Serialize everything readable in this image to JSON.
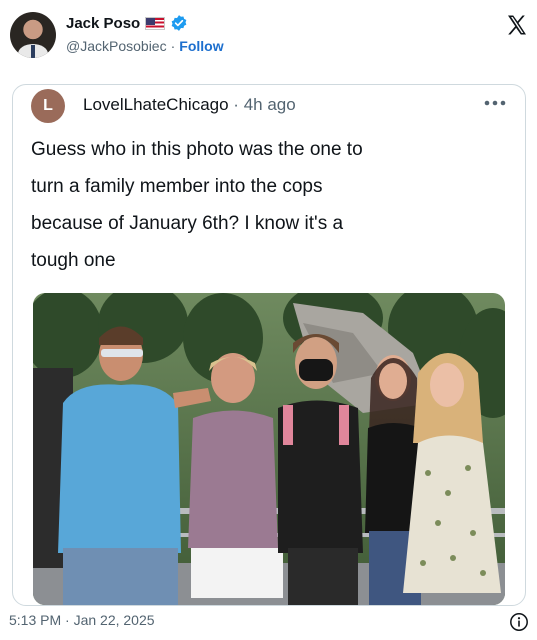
{
  "author": {
    "display_name": "Jack Poso",
    "handle": "@JackPosobiec",
    "separator": "·",
    "follow_label": "Follow",
    "flag_icon": "us-flag-icon",
    "verified_icon": "verified-badge-icon"
  },
  "brand_icon": "x-logo-icon",
  "quoted": {
    "avatar_letter": "L",
    "username": "LovelLhateChicago",
    "separator": "·",
    "time": "4h ago",
    "more_icon": "more-dots-icon",
    "text_lines": [
      "Guess who in this photo was the one to",
      "turn a family member into the cops",
      "because of January 6th? I know it's a",
      "tough one"
    ]
  },
  "photo": {
    "description_icon": "group-photo-image"
  },
  "footer": {
    "timestamp": "5:13 PM · Jan 22, 2025",
    "info_icon": "info-icon"
  },
  "colors": {
    "link": "#1d6fce",
    "muted": "#536471",
    "border": "#cfd9de",
    "quoted_avatar": "#9a6b5a"
  }
}
